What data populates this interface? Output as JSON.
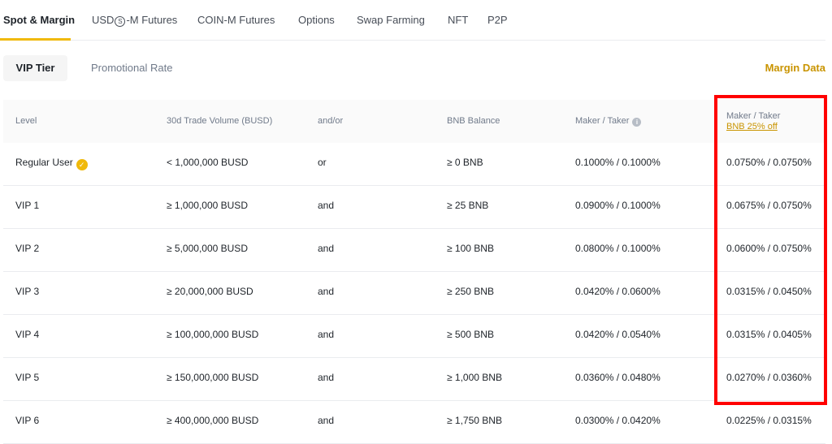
{
  "tabs": [
    {
      "label": "Spot & Margin"
    },
    {
      "label_prefix": "USD",
      "label_circle": "S",
      "label_suffix": "-M Futures"
    },
    {
      "label": "COIN-M Futures"
    },
    {
      "label": "Options"
    },
    {
      "label": "Swap Farming"
    },
    {
      "label": "NFT"
    },
    {
      "label": "P2P"
    }
  ],
  "subtabs": [
    {
      "label": "VIP Tier"
    },
    {
      "label": "Promotional Rate"
    }
  ],
  "margin_link": "Margin Data",
  "columns": {
    "level": "Level",
    "volume": "30d Trade Volume (BUSD)",
    "andor": "and/or",
    "bnb": "BNB Balance",
    "maker_taker": "Maker / Taker",
    "maker_taker_discount": "Maker / Taker",
    "discount_label": "BNB 25% off"
  },
  "rows": [
    {
      "level": "Regular User",
      "volume": "< 1,000,000 BUSD",
      "andor": "or",
      "bnb": "≥ 0 BNB",
      "fee": "0.1000% / 0.1000%",
      "discount": "0.0750% / 0.0750%"
    },
    {
      "level": "VIP 1",
      "volume": "≥ 1,000,000 BUSD",
      "andor": "and",
      "bnb": "≥ 25 BNB",
      "fee": "0.0900% / 0.1000%",
      "discount": "0.0675% / 0.0750%"
    },
    {
      "level": "VIP 2",
      "volume": "≥ 5,000,000 BUSD",
      "andor": "and",
      "bnb": "≥ 100 BNB",
      "fee": "0.0800% / 0.1000%",
      "discount": "0.0600% / 0.0750%"
    },
    {
      "level": "VIP 3",
      "volume": "≥ 20,000,000 BUSD",
      "andor": "and",
      "bnb": "≥ 250 BNB",
      "fee": "0.0420% / 0.0600%",
      "discount": "0.0315% / 0.0450%"
    },
    {
      "level": "VIP 4",
      "volume": "≥ 100,000,000 BUSD",
      "andor": "and",
      "bnb": "≥ 500 BNB",
      "fee": "0.0420% / 0.0540%",
      "discount": "0.0315% / 0.0405%"
    },
    {
      "level": "VIP 5",
      "volume": "≥ 150,000,000 BUSD",
      "andor": "and",
      "bnb": "≥ 1,000 BNB",
      "fee": "0.0360% / 0.0480%",
      "discount": "0.0270% / 0.0360%"
    },
    {
      "level": "VIP 6",
      "volume": "≥ 400,000,000 BUSD",
      "andor": "and",
      "bnb": "≥ 1,750 BNB",
      "fee": "0.0300% / 0.0420%",
      "discount": "0.0225% / 0.0315%"
    }
  ],
  "colors": {
    "accent": "#f0b90b",
    "link": "#c99400",
    "highlight": "#ff0000"
  },
  "icons": {
    "regular_user_badge": "verified-badge-icon",
    "maker_taker_info": "info-icon"
  }
}
